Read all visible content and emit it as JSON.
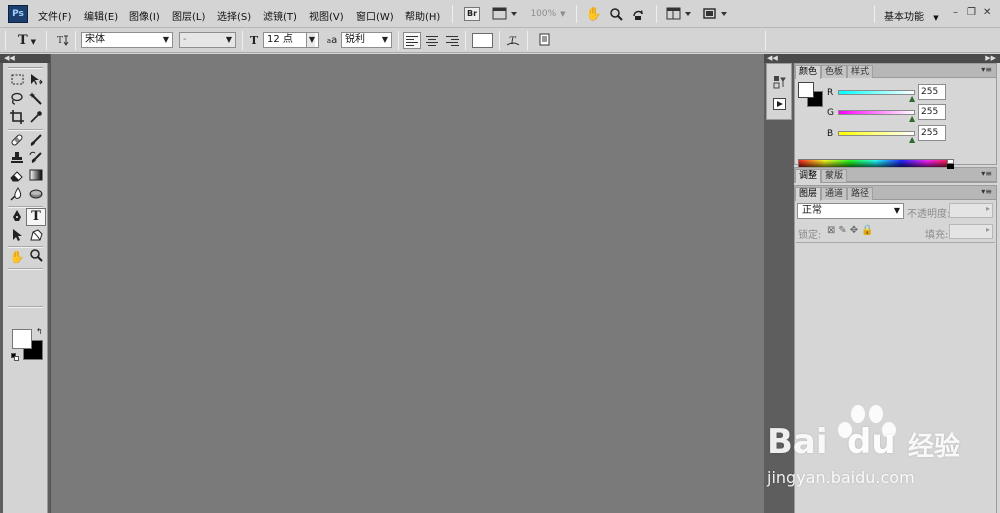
{
  "app": {
    "logo": "Ps",
    "menus": [
      "文件(F)",
      "编辑(E)",
      "图像(I)",
      "图层(L)",
      "选择(S)",
      "滤镜(T)",
      "视图(V)",
      "窗口(W)",
      "帮助(H)"
    ],
    "bridge_label": "Br",
    "zoom": "100%",
    "workspace": "基本功能",
    "window_controls": {
      "minimize": "–",
      "restore": "❐",
      "close": "✕"
    }
  },
  "options_bar": {
    "tool_icon": "T",
    "font_family": "宋体",
    "font_style": "-",
    "size_icon": "T",
    "font_size": "12 点",
    "aa_icon": "a",
    "anti_alias": "锐利"
  },
  "color_panel": {
    "tabs": [
      "颜色",
      "色板",
      "样式"
    ],
    "active_tab": "颜色",
    "channels": [
      {
        "label": "R",
        "value": "255"
      },
      {
        "label": "G",
        "value": "255"
      },
      {
        "label": "B",
        "value": "255"
      }
    ],
    "foreground": "#ffffff",
    "background": "#000000"
  },
  "adjust_panel": {
    "tabs": [
      "调整",
      "蒙版"
    ]
  },
  "layers_panel": {
    "tabs": [
      "图层",
      "通道",
      "路径"
    ],
    "blend_mode": "正常",
    "opacity_label": "不透明度:",
    "lock_label": "锁定:",
    "fill_label": "填充:"
  },
  "watermark": {
    "brand_bai": "Bai",
    "brand_du": "du",
    "brand_cn": "经验",
    "url": "jingyan.baidu.com"
  },
  "colors": {
    "canvas": "#7a7a7a",
    "chrome": "#d4d4d4",
    "dark_strip": "#5e5e5e"
  }
}
